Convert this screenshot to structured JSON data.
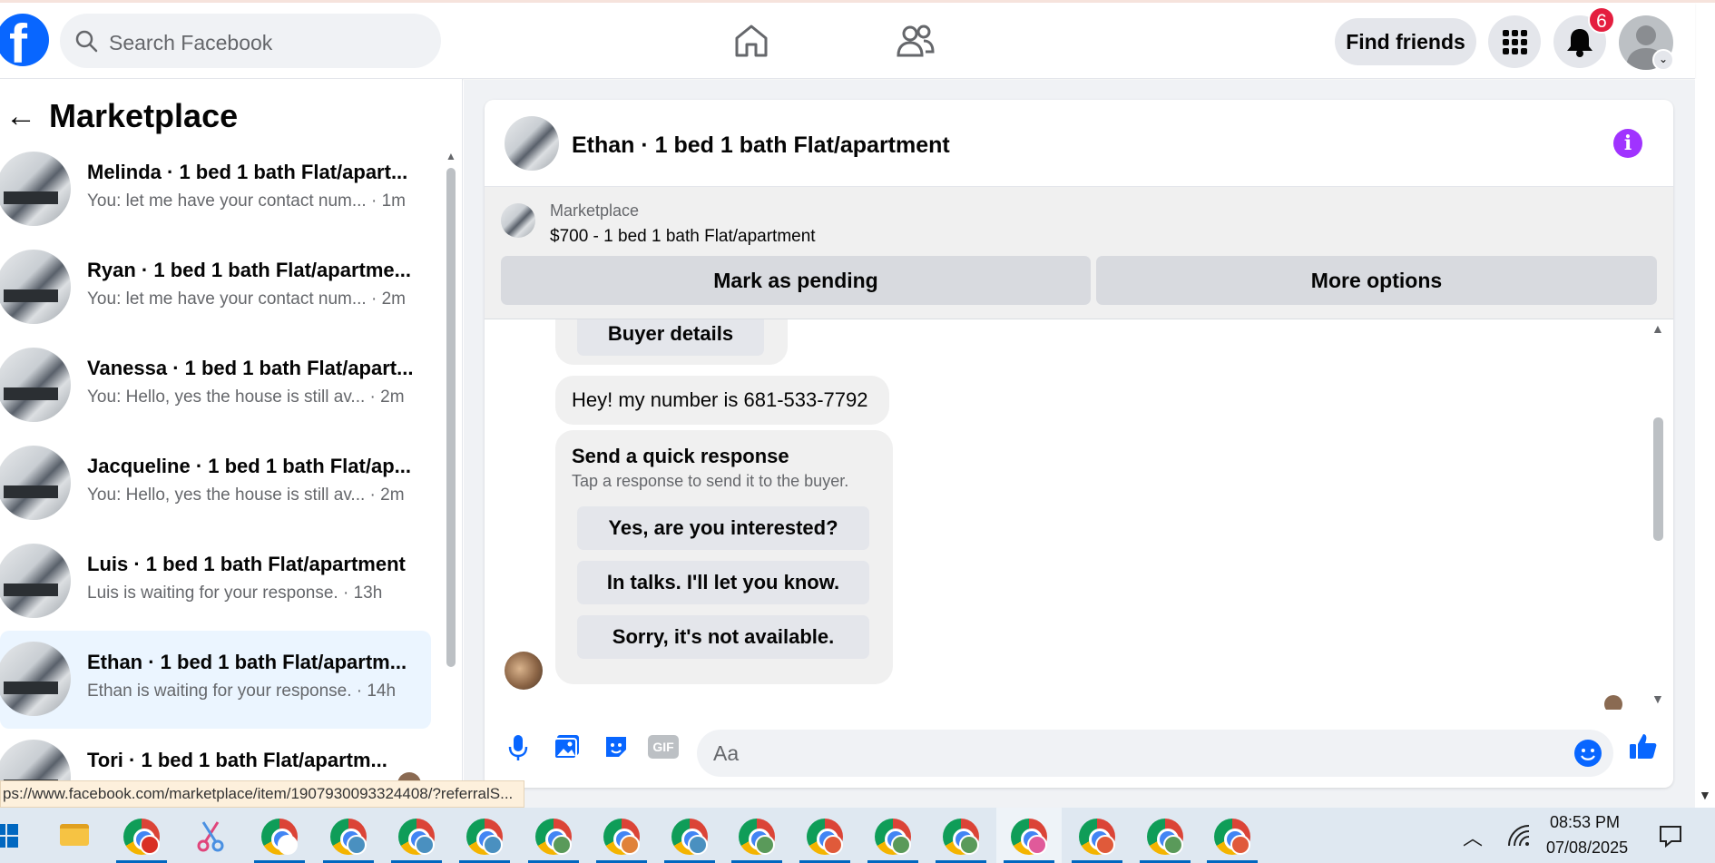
{
  "header": {
    "search_placeholder": "Search Facebook",
    "find_friends": "Find friends",
    "notification_count": "6",
    "logo_letter": "f"
  },
  "sidebar": {
    "title": "Marketplace",
    "conversations": [
      {
        "name": "Melinda · 1 bed 1 bath Flat/apart...",
        "snippet": "You: let me have your contact num... · 1m"
      },
      {
        "name": "Ryan · 1 bed 1 bath Flat/apartme...",
        "snippet": "You: let me have your contact num... · 2m"
      },
      {
        "name": "Vanessa · 1 bed 1 bath Flat/apart...",
        "snippet": "You: Hello, yes the house is still av... · 2m"
      },
      {
        "name": "Jacqueline · 1 bed 1 bath Flat/ap...",
        "snippet": "You: Hello, yes the house is still av... · 2m"
      },
      {
        "name": "Luis · 1 bed 1 bath Flat/apartment",
        "snippet": "Luis is waiting for your response. · 13h"
      },
      {
        "name": "Ethan · 1 bed 1 bath Flat/apartm...",
        "snippet": "Ethan is waiting for your response. · 14h"
      },
      {
        "name": "Tori · 1 bed 1 bath Flat/apartm...",
        "snippet": ""
      }
    ]
  },
  "chat": {
    "title": "Ethan · 1 bed 1 bath Flat/apartment",
    "listing_label": "Marketplace",
    "listing_price": "$700 - 1 bed 1 bath Flat/apartment",
    "mark_pending": "Mark as pending",
    "more_options": "More options",
    "buyer_details": "Buyer details",
    "message_number": "Hey! my number is 681-533-7792",
    "quick_title": "Send a quick response",
    "quick_subtitle": "Tap a response to send it to the buyer.",
    "quick_responses": [
      "Yes, are you interested?",
      "In talks. I'll let you know.",
      "Sorry, it's not available."
    ],
    "composer_placeholder": "Aa",
    "gif_label": "GIF"
  },
  "status_url": "ps://www.facebook.com/marketplace/item/1907930093324408/?referralS...",
  "taskbar": {
    "time": "08:53 PM",
    "date": "07/08/2025",
    "profile_colors": [
      "#d93025",
      "#ffffff",
      "#4a90c0",
      "#4a90c0",
      "#4a90c0",
      "#5a9a5a",
      "#e0823a",
      "#4a90c0",
      "#5a9a5a",
      "#e05a3a",
      "#5a9a5a",
      "#5a9a5a",
      "#e05a9a",
      "#e05a3a",
      "#5a9a5a",
      "#e05a3a",
      "#e0823a"
    ]
  },
  "colors": {
    "brand": "#0866ff",
    "info": "#a033ff",
    "notification": "#e41e3f",
    "active_conv": "#ebf5ff"
  }
}
